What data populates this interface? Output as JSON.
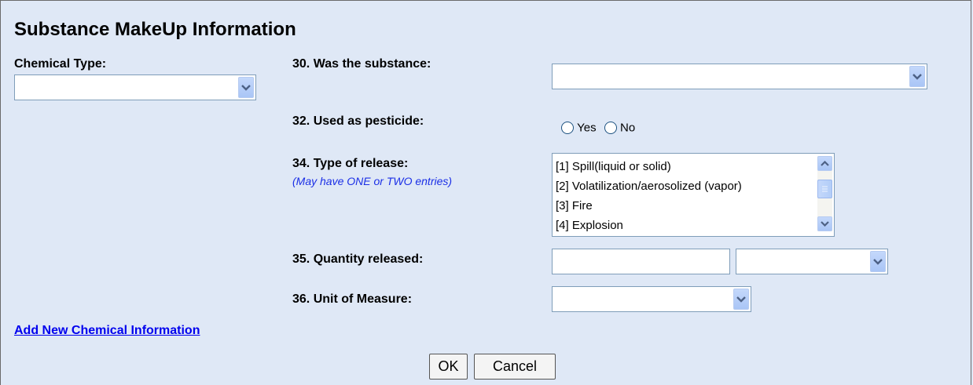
{
  "title": "Substance MakeUp Information",
  "chemical_type": {
    "label": "Chemical Type:",
    "value": ""
  },
  "q30": {
    "label": "30. Was the substance:",
    "value": ""
  },
  "q32": {
    "label": "32. Used as pesticide:",
    "yes_label": "Yes",
    "no_label": "No"
  },
  "q34": {
    "label": "34. Type of release:",
    "note": "(May have ONE or TWO entries)",
    "options": [
      "[1] Spill(liquid or solid)",
      "[2] Volatilization/aerosolized (vapor)",
      "[3] Fire",
      "[4] Explosion"
    ]
  },
  "q35": {
    "label": "35. Quantity released:",
    "quantity_value": "",
    "unit_value": ""
  },
  "q36": {
    "label": "36. Unit of Measure:",
    "value": ""
  },
  "add_link": "Add New Chemical Information",
  "buttons": {
    "ok": "OK",
    "cancel": "Cancel"
  },
  "colors": {
    "background": "#dfe8f6",
    "note": "#1a2ee6",
    "link": "#0000ee"
  }
}
